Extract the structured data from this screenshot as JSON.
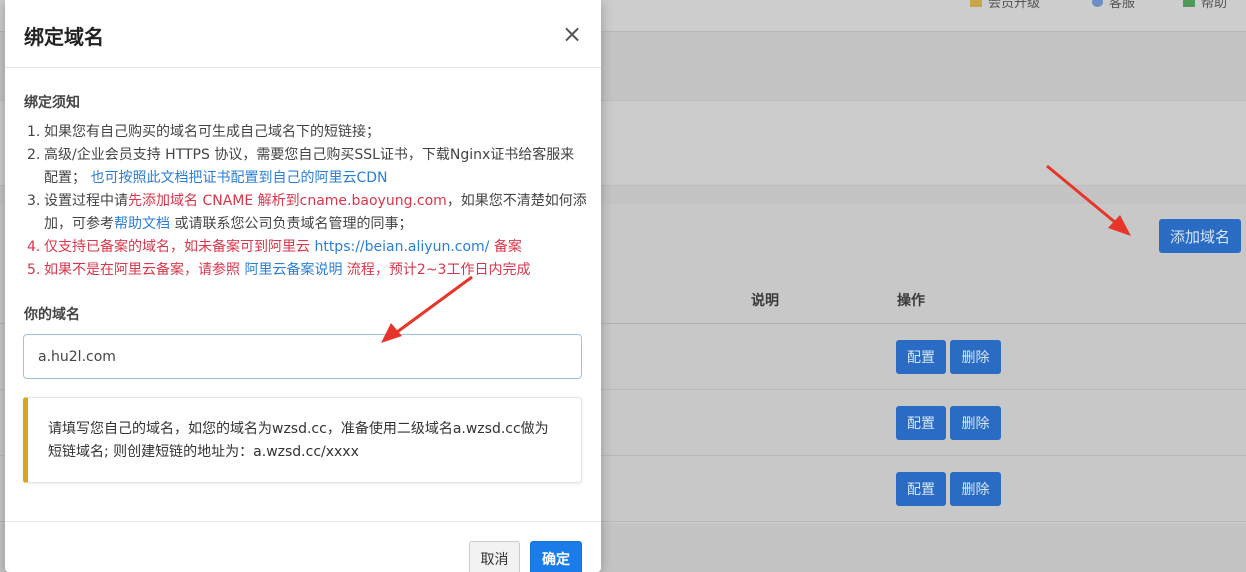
{
  "background": {
    "top_items": [
      "会员升级",
      "客服",
      "帮助"
    ],
    "add_domain_label": "添加域名",
    "table_headers": [
      "说明",
      "操作"
    ],
    "row_actions": {
      "config": "配置",
      "delete": "删除"
    }
  },
  "modal": {
    "title": "绑定域名",
    "close_symbol": "×",
    "notice_title": "绑定须知",
    "notes": [
      {
        "num": "1.",
        "text": "如果您有自己购买的域名可生成自己域名下的短链接；"
      },
      {
        "num": "2.",
        "text": "高级/企业会员支持 HTTPS 协议，需要您自己购买SSL证书，下载Nginx证书给客服来配置；",
        "link": "也可按照此文档把证书配置到自己的阿里云CDN"
      },
      {
        "num": "3.",
        "prefix": "设置过程中请",
        "red": "先添加域名 CNAME 解析到cname.baoyung.com",
        "mid": "，如果您不清楚如何添加，可参考",
        "link": "帮助文档",
        "suffix": " 或请联系您公司负责域名管理的同事；"
      },
      {
        "num": "4.",
        "red1": "仅支持已备案的域名，如未备案可到阿里云 ",
        "link": "https://beian.aliyun.com/",
        "red2": " 备案"
      },
      {
        "num": "5.",
        "red1": "如果不是在阿里云备案，请参照 ",
        "link": "阿里云备案说明",
        "red2": " 流程，预计2~3工作日内完成"
      }
    ],
    "domain_label": "你的域名",
    "domain_value": "a.hu2l.com",
    "tip_text": "请填写您自己的域名，如您的域名为wzsd.cc，准备使用二级域名a.wzsd.cc做为短链域名; 则创建短链的地址为：a.wzsd.cc/xxxx",
    "cancel_label": "取消",
    "ok_label": "确定"
  },
  "colors": {
    "primary": "#1a7ce8",
    "warning_bar": "#d9a521",
    "danger_text": "#d9364b",
    "link": "#2a7fd4"
  }
}
